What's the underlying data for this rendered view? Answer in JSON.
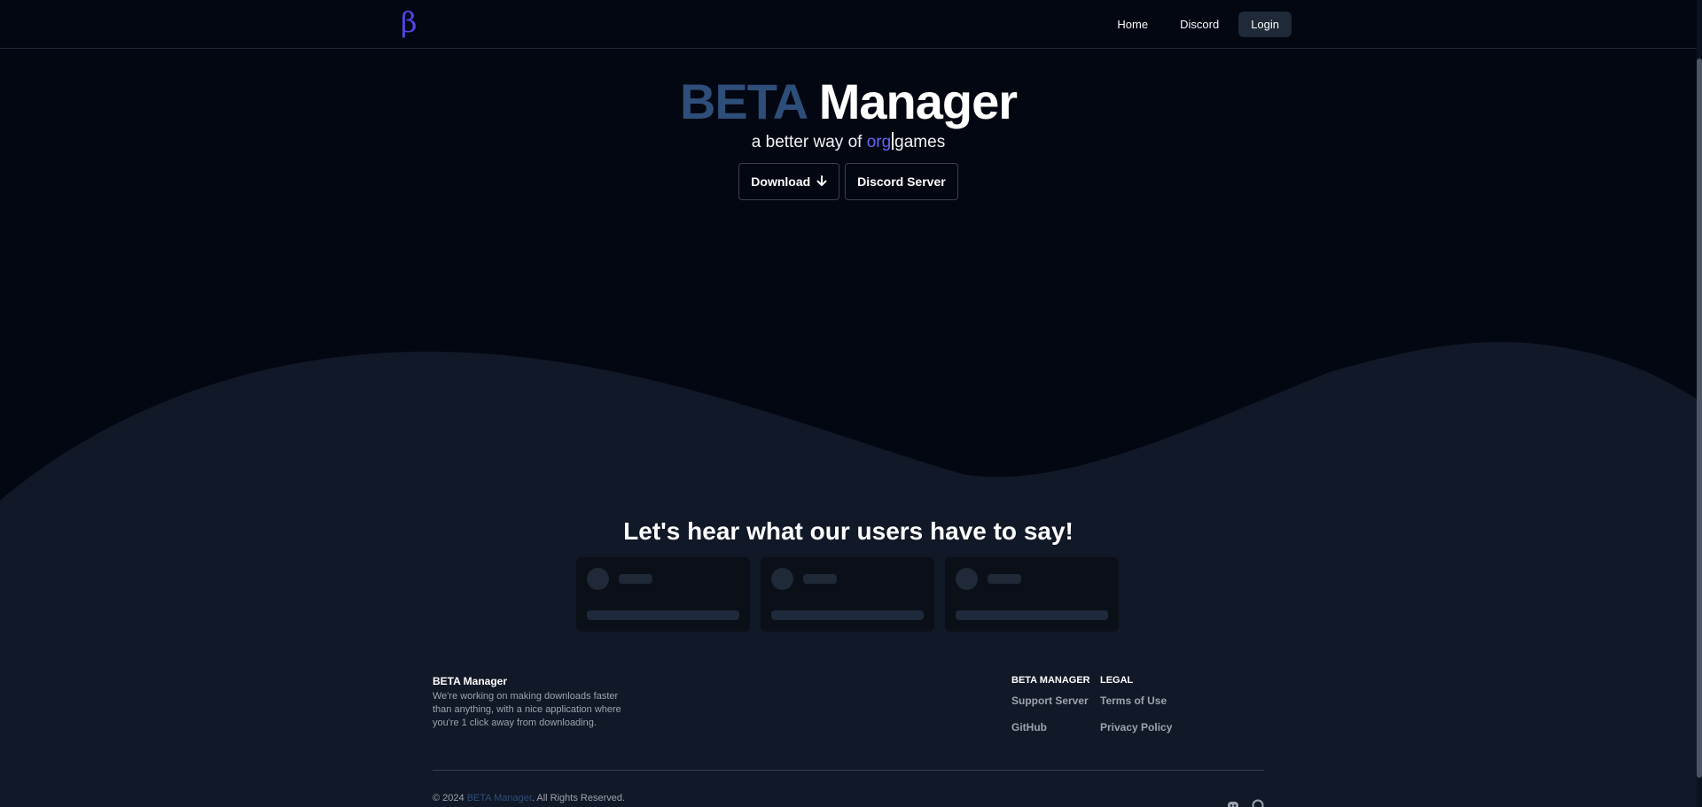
{
  "header": {
    "logo": "β",
    "nav": [
      {
        "label": "Home"
      },
      {
        "label": "Discord"
      },
      {
        "label": "Login"
      }
    ]
  },
  "hero": {
    "title_part1": "BETA",
    "title_part2": "Manager",
    "subtitle_prefix": "a better way of ",
    "subtitle_accent": "org",
    "subtitle_suffix": "games",
    "download_label": "Download",
    "discord_label": "Discord Server"
  },
  "testimonials": {
    "title": "Let's hear what our users have to say!"
  },
  "footer": {
    "brand": "BETA Manager",
    "description": "We're working on making downloads faster than anything, with a nice application where you're 1 click away from downloading.",
    "col1": {
      "heading": "BETA MANAGER",
      "links": [
        "Support Server",
        "GitHub"
      ]
    },
    "col2": {
      "heading": "LEGAL",
      "links": [
        "Terms of Use",
        "Privacy Policy"
      ]
    },
    "copyright_prefix": "© 2024 ",
    "copyright_brand": "BETA Manager",
    "copyright_suffix": ". All Rights Reserved."
  },
  "colors": {
    "background": "#030712",
    "wave": "#111827",
    "accent": "#6366f1",
    "brand_blue": "#2e4e7a"
  },
  "icons": {
    "download": "arrow-down-icon",
    "social": [
      "discord-icon",
      "github-icon"
    ]
  }
}
